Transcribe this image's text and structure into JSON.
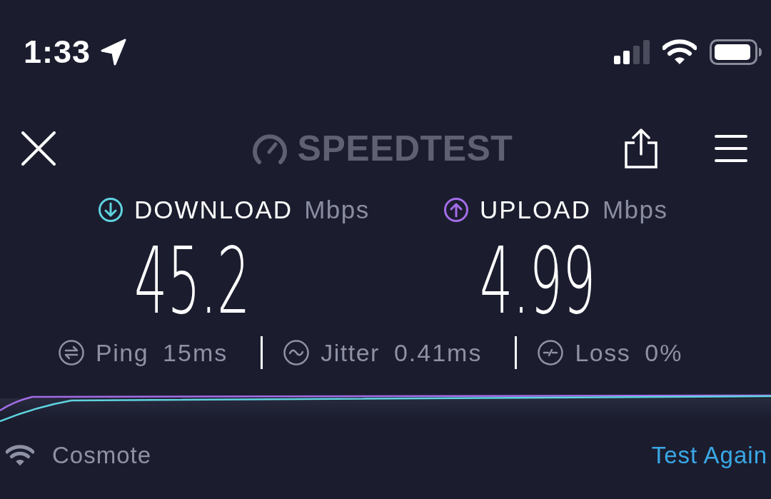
{
  "status_bar": {
    "time": "1:33"
  },
  "header": {
    "logo_text": "SPEEDTEST"
  },
  "results": [
    {
      "kind": "download",
      "label": "DOWNLOAD",
      "unit": "Mbps",
      "value": "45.2",
      "color": "#5ed3df"
    },
    {
      "kind": "upload",
      "label": "UPLOAD",
      "unit": "Mbps",
      "value": "4.99",
      "color": "#a46de8"
    }
  ],
  "metrics": [
    {
      "kind": "ping",
      "label": "Ping",
      "value": "15ms"
    },
    {
      "kind": "jitter",
      "label": "Jitter",
      "value": "0.41ms"
    },
    {
      "kind": "loss",
      "label": "Loss",
      "value": "0%"
    }
  ],
  "footer": {
    "network": "Cosmote",
    "action": "Test Again"
  }
}
